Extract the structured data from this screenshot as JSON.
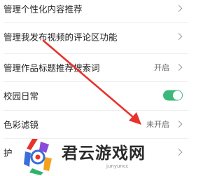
{
  "settings": {
    "rows": [
      {
        "label": "管理个性化内容推荐",
        "value": "",
        "control": "chevron"
      },
      {
        "label": "管理我发布视频的评论区功能",
        "value": "",
        "control": "chevron"
      },
      {
        "label": "管理作品标题推荐搜索词",
        "value": "开启",
        "control": "chevron"
      },
      {
        "label": "校园日常",
        "value": "",
        "control": "toggle",
        "toggle_on": true
      },
      {
        "label": "色彩滤镜",
        "value": "未开启",
        "control": "chevron"
      },
      {
        "label": "护",
        "value": "",
        "control": "chevron"
      }
    ]
  },
  "overlay": {
    "arrow_color": "#e8322b"
  },
  "watermark": {
    "title": "君云游戏网",
    "subtitle": "junyuncc",
    "colors": [
      "#e8322b",
      "#3a6fd8",
      "#f4a21c",
      "#2fb36c",
      "#8b4bd6"
    ]
  },
  "colors": {
    "toggle_on": "#3cb97a",
    "text_primary": "#1f1f1f",
    "text_secondary": "#666666"
  }
}
